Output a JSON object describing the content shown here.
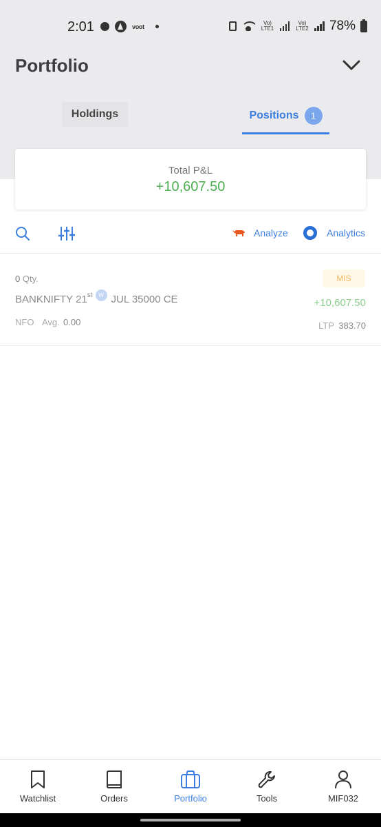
{
  "status_bar": {
    "time": "2:01",
    "app_badge": "voot",
    "lte1": "Vo) LTE1",
    "lte2": "Vo) LTE2",
    "battery": "78%"
  },
  "header": {
    "title": "Portfolio"
  },
  "tabs": {
    "holdings": "Holdings",
    "positions": "Positions",
    "positions_count": "1"
  },
  "pnl": {
    "label": "Total P&L",
    "value": "+10,607.50"
  },
  "toolbar": {
    "analyze": "Analyze",
    "analytics": "Analytics"
  },
  "position": {
    "qty": "0",
    "qty_label": "Qty.",
    "product": "MIS",
    "symbol": "BANKNIFTY 21",
    "day_suffix": "st",
    "weekly": "W",
    "contract": "JUL 35000 CE",
    "pnl": "+10,607.50",
    "exchange": "NFO",
    "avg_label": "Avg.",
    "avg_value": "0.00",
    "ltp_label": "LTP",
    "ltp_value": "383.70"
  },
  "bottom_nav": [
    {
      "label": "Watchlist"
    },
    {
      "label": "Orders"
    },
    {
      "label": "Portfolio"
    },
    {
      "label": "Tools"
    },
    {
      "label": "MIF032"
    }
  ],
  "colors": {
    "accent": "#3d7fe0",
    "profit": "#4caf50",
    "header_bg": "#ebebed",
    "analyze": "#e8581c"
  }
}
